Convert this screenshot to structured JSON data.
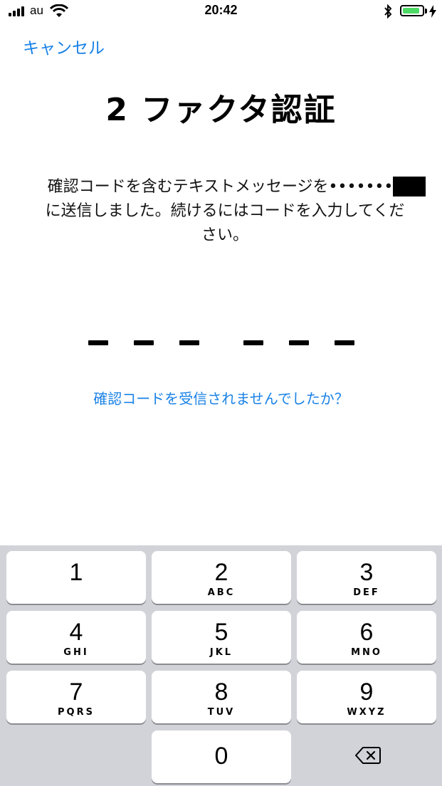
{
  "status_bar": {
    "carrier": "au",
    "time": "20:42",
    "battery_level": 0.9,
    "battery_color": "#4cd964"
  },
  "nav": {
    "cancel_label": "キャンセル"
  },
  "title": "2 ファクタ認証",
  "message": {
    "line1": "確認コードを含むテキストメッセージを••••••••",
    "line2": "に送信しました。続けるにはコードを入力してくだ",
    "line3": "さい。"
  },
  "code_input": {
    "length": 6,
    "filled": 0
  },
  "resend_label": "確認コードを受信されませんでしたか？",
  "accent_color": "#1a82e6",
  "keypad": {
    "keys": [
      {
        "digit": "1",
        "letters": ""
      },
      {
        "digit": "2",
        "letters": "ABC"
      },
      {
        "digit": "3",
        "letters": "DEF"
      },
      {
        "digit": "4",
        "letters": "GHI"
      },
      {
        "digit": "5",
        "letters": "JKL"
      },
      {
        "digit": "6",
        "letters": "MNO"
      },
      {
        "digit": "7",
        "letters": "PQRS"
      },
      {
        "digit": "8",
        "letters": "TUV"
      },
      {
        "digit": "9",
        "letters": "WXYZ"
      },
      {
        "digit": "0",
        "letters": ""
      }
    ],
    "delete_icon": "backspace-icon"
  }
}
